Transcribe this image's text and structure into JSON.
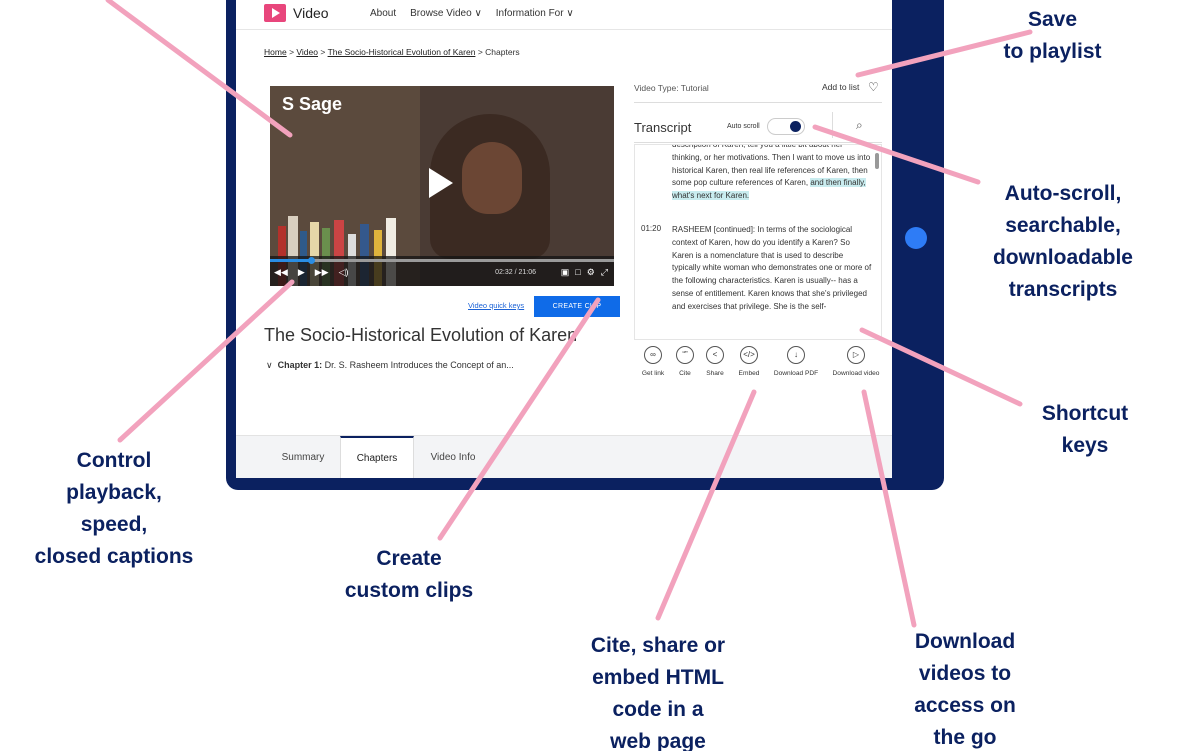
{
  "nav": {
    "brand": "Video",
    "links": [
      "About",
      "Browse Video ∨",
      "Information For ∨"
    ]
  },
  "breadcrumb": {
    "home": "Home",
    "sep": ">",
    "video": "Video",
    "title": "The Socio-Historical Evolution of Karen",
    "current": "Chapters"
  },
  "player": {
    "watermark": "S Sage",
    "time": "02:32 / 21:06",
    "progress_fraction": 0.12
  },
  "clip": {
    "quick_keys": "Video quick keys",
    "create_clip": "CREATE CLIP"
  },
  "video": {
    "title": "The Socio-Historical Evolution of Karen",
    "chapter_label": "Chapter 1:",
    "chapter_text": "Dr. S. Rasheem Introduces the Concept of an..."
  },
  "tabs": [
    "Summary",
    "Chapters",
    "Video Info"
  ],
  "panel": {
    "video_type": "Video Type: Tutorial",
    "add_to_list": "Add to list",
    "transcript_title": "Transcript",
    "auto_scroll": "Auto scroll"
  },
  "transcript": {
    "block1": "description of Karen, tell you a little bit about her thinking, or her motivations. Then I want to move us into historical Karen, then real life references of Karen, then some pop culture references of Karen,",
    "block1_hl": "and then finally, what's next for Karen.",
    "ts2": "01:20",
    "block2": "RASHEEM [continued]: In terms of the sociological context of Karen, how do you identify a Karen? So Karen is a nomenclature that is used to describe typically white woman who demonstrates one or more of the following characteristics. Karen is usually-- has a sense of entitlement. Karen knows that she's privileged and exercises that privilege. She is the self-"
  },
  "actions": [
    "Get link",
    "Cite",
    "Share",
    "Embed",
    "Download PDF",
    "Download video"
  ],
  "annotations": {
    "save": [
      "Save",
      "to playlist"
    ],
    "autoscroll": [
      "Auto-scroll,",
      "searchable,",
      "downloadable",
      "transcripts"
    ],
    "shortcut": [
      "Shortcut",
      "keys"
    ],
    "control": [
      "Control",
      "playback,",
      "speed,",
      "closed captions"
    ],
    "clips": [
      "Create",
      "custom clips"
    ],
    "cite": [
      "Cite, share or",
      "embed HTML",
      "code in a",
      "web page"
    ],
    "download": [
      "Download",
      "videos to",
      "access on",
      "the go"
    ]
  },
  "colors": {
    "frame": "#0b2160",
    "accent": "#0f6be8",
    "brand_pink": "#e8467c",
    "callout_line": "#f2a2bd",
    "annotation_text": "#0b2160"
  }
}
